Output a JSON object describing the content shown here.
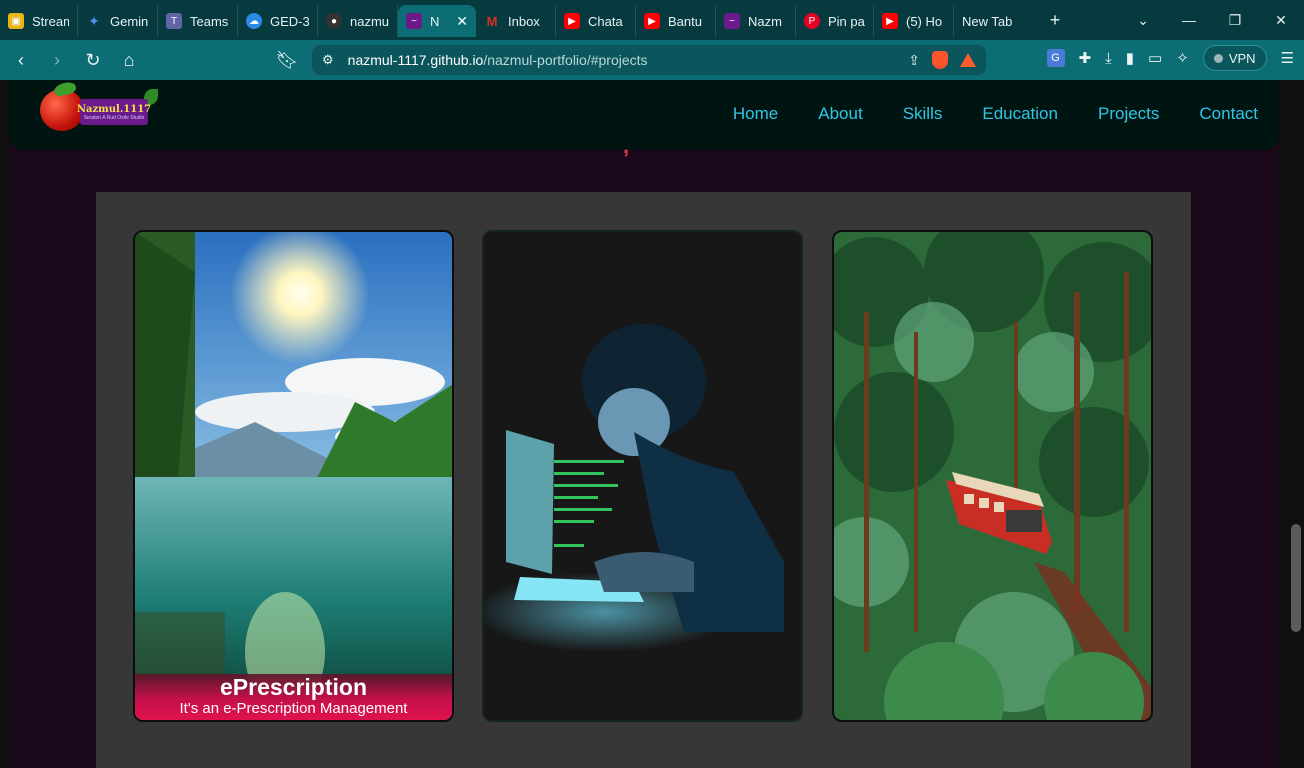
{
  "browser": {
    "tabs": [
      {
        "label": "Stream",
        "icon": "stream-icon",
        "color": "#e8b516"
      },
      {
        "label": "Gemin",
        "icon": "gemini-icon",
        "color": "#4b8df8"
      },
      {
        "label": "Teams",
        "icon": "teams-icon",
        "color": "#6264a7"
      },
      {
        "label": "GED-3",
        "icon": "onedrive-icon",
        "color": "#2a8ae6"
      },
      {
        "label": "nazmu",
        "icon": "github-icon",
        "color": "#333"
      },
      {
        "label": "N",
        "icon": "portfolio-icon",
        "color": "#6a1a8a",
        "active": true
      },
      {
        "label": "Inbox",
        "icon": "gmail-icon",
        "color": "#d93025"
      },
      {
        "label": "Chata",
        "icon": "youtube-icon",
        "color": "#ff0000"
      },
      {
        "label": "Bantu",
        "icon": "youtube-icon",
        "color": "#ff0000"
      },
      {
        "label": "Nazm",
        "icon": "portfolio-icon",
        "color": "#6a1a8a"
      },
      {
        "label": "Pin pa",
        "icon": "pinterest-icon",
        "color": "#e60023"
      },
      {
        "label": "(5) Ho",
        "icon": "youtube-icon",
        "color": "#ff0000"
      },
      {
        "label": "New Tab",
        "icon": "",
        "color": ""
      }
    ],
    "url_host": "nazmul-1117.github.io",
    "url_path": "/nazmul-portfolio/#projects",
    "vpn_label": "VPN"
  },
  "site": {
    "logo_name": "Nazmul.1117",
    "logo_tagline": "Seraton A Rud Oxtle Studio",
    "nav": [
      "Home",
      "About",
      "Skills",
      "Education",
      "Projects",
      "Contact"
    ]
  },
  "projects": [
    {
      "title": "ePrescription",
      "desc": "It's an e-Prescription Management",
      "image": "lake-sunlight-forest"
    },
    {
      "title": "",
      "desc": "",
      "image": "boy-coding-laptop"
    },
    {
      "title": "",
      "desc": "",
      "image": "red-train-forest"
    }
  ]
}
